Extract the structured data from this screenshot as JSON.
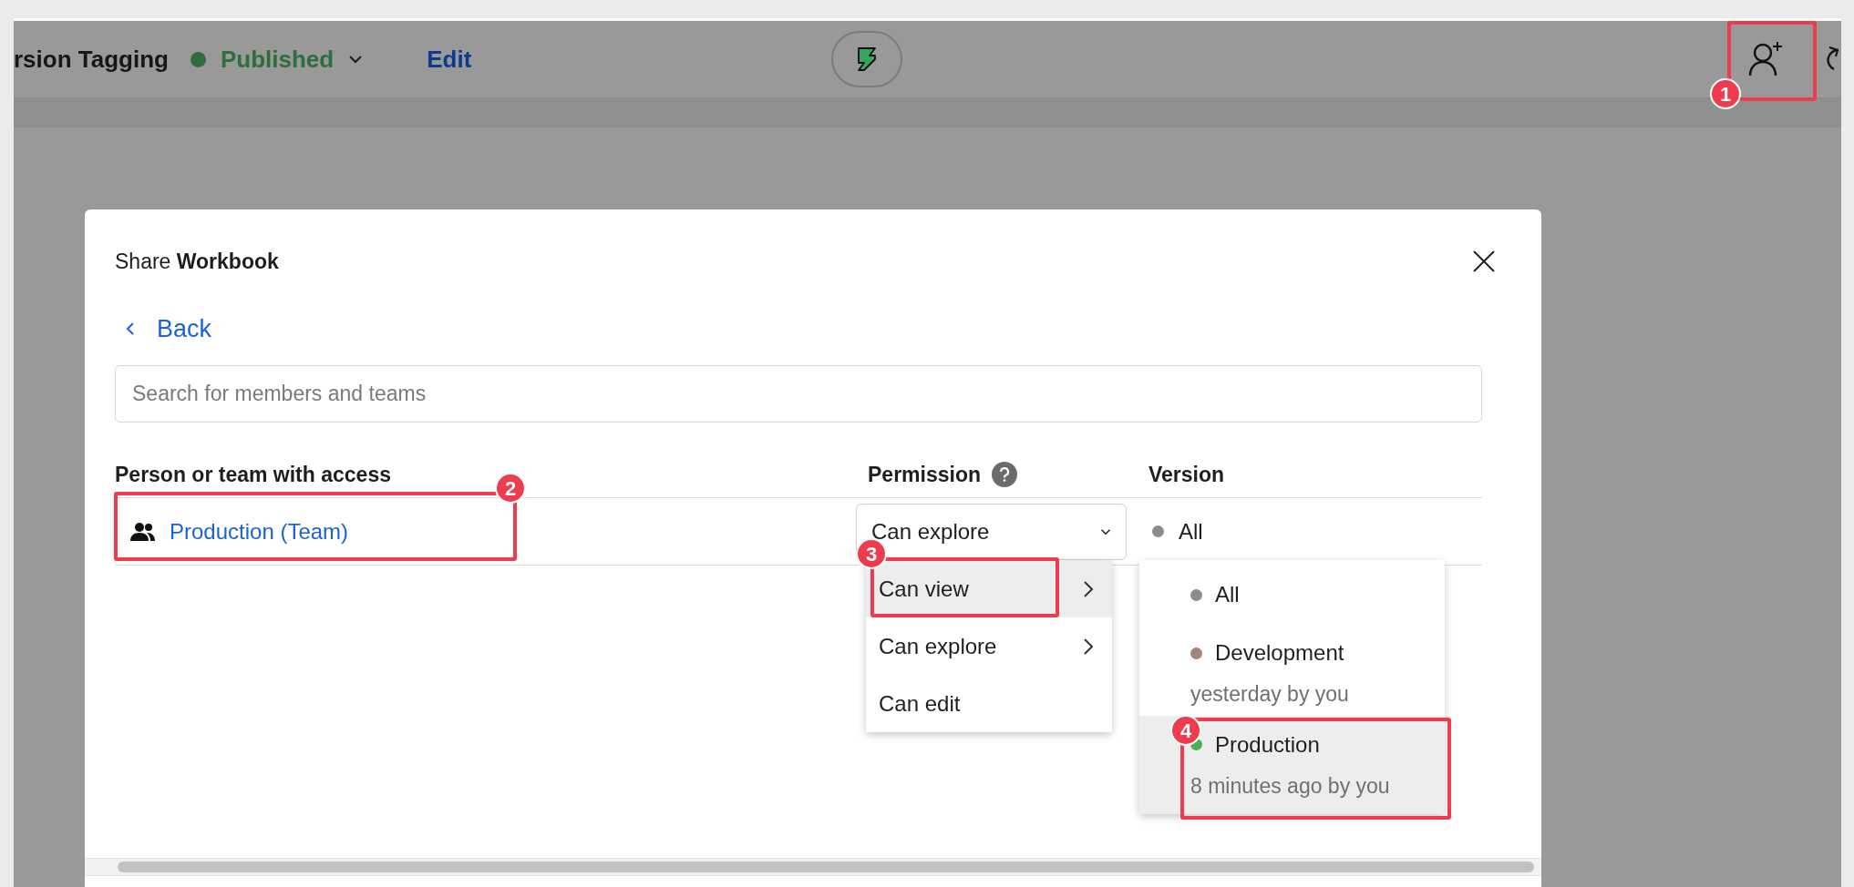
{
  "top_bar": {
    "title": "rsion Tagging",
    "status": {
      "label": "Published",
      "color": "#2f6e3c"
    },
    "edit_link": "Edit"
  },
  "dialog": {
    "title": "Share **Workbook**",
    "back": "Back",
    "search": {
      "placeholder": "Search for members and teams"
    },
    "columns": [
      "Person or team with access",
      "Permission",
      "Version"
    ],
    "rows": [
      {
        "name": "Production (Team)",
        "permission": "Can explore",
        "version": {
          "label": "All",
          "color": "#8c8c8c"
        }
      }
    ],
    "permission_menu": [
      {
        "label": "Can view",
        "submenu": true,
        "selected": true
      },
      {
        "label": "Can explore",
        "submenu": true,
        "selected": false
      },
      {
        "label": "Can edit",
        "submenu": false,
        "selected": false
      }
    ],
    "version_menu": [
      {
        "label": "All",
        "color": "#8c8c8c",
        "selected": false
      },
      {
        "label": "Development",
        "color": "#a38372",
        "meta": "yesterday by you",
        "selected": false
      },
      {
        "label": "Production",
        "color": "#4caf5c",
        "meta": "8 minutes ago by you",
        "selected": true
      }
    ]
  },
  "callouts": [
    {
      "number": "1"
    },
    {
      "number": "2"
    },
    {
      "number": "3"
    },
    {
      "number": "4"
    }
  ]
}
